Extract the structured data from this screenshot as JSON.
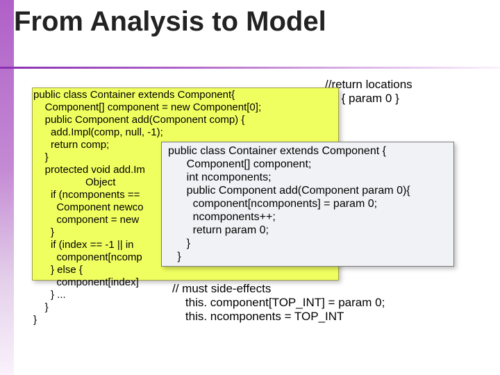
{
  "slide": {
    "title": "From Analysis to Model",
    "top_note": "//return locations\n     { param 0 }",
    "code_left": "public class Container extends Component{\n    Component[] component = new Component[0];\n    public Component add(Component comp) {\n      add.Impl(comp, null, -1);\n      return comp;\n    }\n    protected void add.Im\n                  Object \n      if (ncomponents ==\n        Component newco\n        component = new\n      }\n      if (index == -1 || in\n        component[ncomp\n      } else {\n        component[index]\n      } ...\n    }\n}",
    "code_right": "public class Container extends Component {\n      Component[] component;\n      int ncomponents;\n      public Component add(Component param 0){\n        component[ncomponents] = param 0;\n        ncomponents++;\n        return param 0;\n      }\n   }",
    "bottom_note": "// must side-effects\n    this. component[TOP_INT] = param 0;\n    this. ncomponents = TOP_INT"
  }
}
